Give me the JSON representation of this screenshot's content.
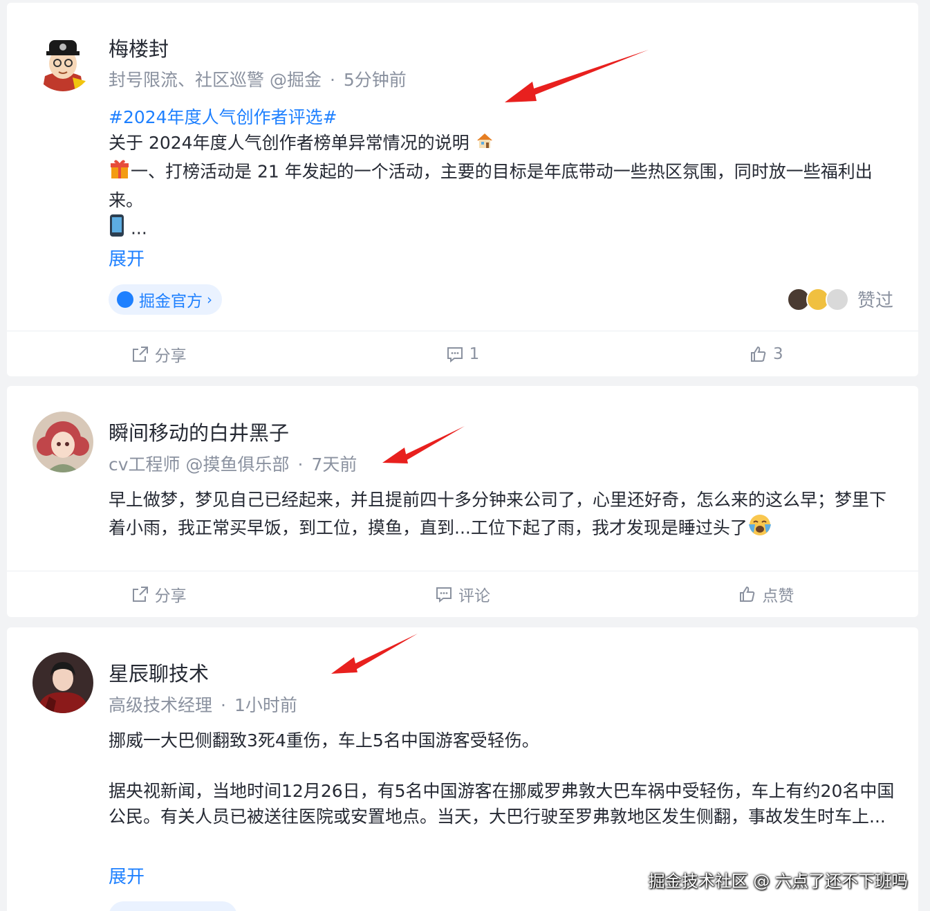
{
  "colors": {
    "accent": "#1e80ff",
    "muted": "#8a919f",
    "text": "#252933",
    "annotation_arrow": "#e8201e"
  },
  "posts": [
    {
      "author": "梅楼封",
      "meta_title": "封号限流、社区巡警 @掘金",
      "time": "5分钟前",
      "topic": "#2024年度人气创作者评选#",
      "line1": "关于 2024年度人气创作者榜单异常情况的说明",
      "line1_emoji": "house-icon",
      "line2": "一、打榜活动是 21 年发起的一个活动，主要的目标是年底带动一些热区氛围，同时放一些福利出来。",
      "line2_emoji": "gift-icon",
      "line3": "...",
      "line3_emoji": "phone-icon",
      "expand": "展开",
      "circle": "掘金官方",
      "liked": "赞过",
      "actions": {
        "share": "分享",
        "comment": "1",
        "like": "3"
      }
    },
    {
      "author": "瞬间移动的白井黑子",
      "meta_title": "cv工程师 @摸鱼俱乐部",
      "time": "7天前",
      "content": "早上做梦，梦见自己已经起来，并且提前四十多分钟来公司了，心里还好奇，怎么来的这么早；梦里下着小雨，我正常买早饭，到工位，摸鱼，直到...工位下起了雨，我才发现是睡过头了",
      "content_emoji": "crying-face-icon",
      "actions": {
        "share": "分享",
        "comment": "评论",
        "like": "点赞"
      }
    },
    {
      "author": "星辰聊技术",
      "meta_title": "高级技术经理",
      "time": "1小时前",
      "headline": "挪威一大巴侧翻致3死4重伤，车上5名中国游客受轻伤。",
      "content": "据央视新闻，当地时间12月26日，有5名中国游客在挪威罗弗敦大巴车祸中受轻伤，车上有约20名中国公民。有关人员已被送往医院或安置地点。当天，大巴行驶至罗弗敦地区发生侧翻，事故发生时车上...",
      "expand": "展开"
    }
  ],
  "watermark": "掘金技术社区 @ 六点了还不下班吗"
}
